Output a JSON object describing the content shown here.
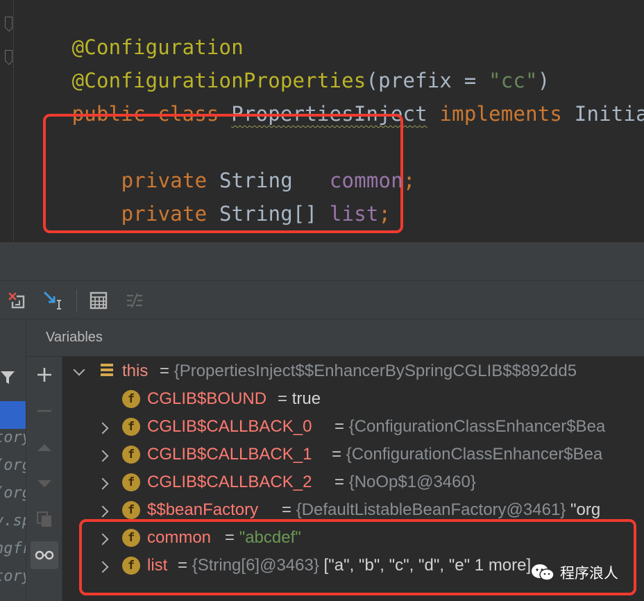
{
  "editor": {
    "line1": "@Configuration",
    "line2_annotation": "@ConfigurationProperties",
    "line2_open": "(prefix = ",
    "line2_string": "\"cc\"",
    "line2_close": ")",
    "line3_public": "public",
    "line3_class": "class",
    "line3_name": "PropertiesInject",
    "line3_implements": "implements",
    "line3_iface": "Initializ",
    "field1_mod": "private",
    "field1_type": "String",
    "field1_name": "common",
    "field1_semi": ";",
    "field2_mod": "private",
    "field2_type": "String[]",
    "field2_name": "list",
    "field2_semi": ";"
  },
  "frames": {
    "rows": [
      "tory",
      "(org",
      "(org",
      "v.sp",
      "ngfr",
      "tory"
    ]
  },
  "variables": {
    "title": "Variables",
    "rows": [
      {
        "name": "this",
        "eq": "=",
        "type": "{PropertiesInject$$EnhancerBySpringCGLIB$$892dd5",
        "value": ""
      },
      {
        "name": "CGLIB$BOUND",
        "eq": "=",
        "type": "",
        "value": "true"
      },
      {
        "name": "CGLIB$CALLBACK_0",
        "eq": "=",
        "type": "{ConfigurationClassEnhancer$Bea",
        "value": ""
      },
      {
        "name": "CGLIB$CALLBACK_1",
        "eq": "=",
        "type": "{ConfigurationClassEnhancer$Bea",
        "value": ""
      },
      {
        "name": "CGLIB$CALLBACK_2",
        "eq": "=",
        "type": "{NoOp$1@3460}",
        "value": ""
      },
      {
        "name": "$$beanFactory",
        "eq": "=",
        "type": "{DefaultListableBeanFactory@3461}",
        "value": "\"org"
      },
      {
        "name": "common",
        "eq": "=",
        "type": "",
        "value": "\"abcdef\""
      },
      {
        "name": "list",
        "eq": "=",
        "type": "{String[6]@3463}",
        "value": "[\"a\", \"b\", \"c\", \"d\", \"e\"  1 more]"
      }
    ]
  },
  "watermark": "程序浪人",
  "colors": {
    "highlight_box": "#f03b2f",
    "keyword": "#cc7832",
    "annotation": "#bbb529",
    "field": "#9876aa",
    "string": "#6a8759",
    "var_name": "#ff7b72",
    "field_badge": "#b89230"
  }
}
